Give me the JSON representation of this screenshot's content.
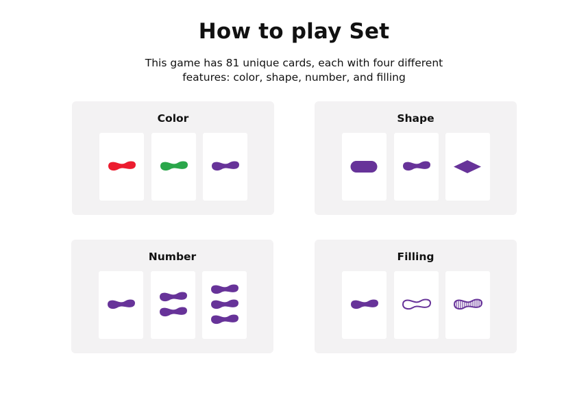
{
  "title": "How to play Set",
  "subtitle": {
    "line1": "This game has 81 unique cards, each with four different",
    "line2": "features: color, shape, number, and filling"
  },
  "colors": {
    "red": "#ec1c2f",
    "green": "#2aa64a",
    "purple": "#673399",
    "panel_bg": "#f3f2f3"
  },
  "panels": [
    {
      "label": "Color",
      "cards": [
        {
          "shape": "squiggle",
          "color": "red",
          "number": 1,
          "filling": "solid"
        },
        {
          "shape": "squiggle",
          "color": "green",
          "number": 1,
          "filling": "solid"
        },
        {
          "shape": "squiggle",
          "color": "purple",
          "number": 1,
          "filling": "solid"
        }
      ]
    },
    {
      "label": "Shape",
      "cards": [
        {
          "shape": "oval",
          "color": "purple",
          "number": 1,
          "filling": "solid"
        },
        {
          "shape": "squiggle",
          "color": "purple",
          "number": 1,
          "filling": "solid"
        },
        {
          "shape": "diamond",
          "color": "purple",
          "number": 1,
          "filling": "solid"
        }
      ]
    },
    {
      "label": "Number",
      "cards": [
        {
          "shape": "squiggle",
          "color": "purple",
          "number": 1,
          "filling": "solid"
        },
        {
          "shape": "squiggle",
          "color": "purple",
          "number": 2,
          "filling": "solid"
        },
        {
          "shape": "squiggle",
          "color": "purple",
          "number": 3,
          "filling": "solid"
        }
      ]
    },
    {
      "label": "Filling",
      "cards": [
        {
          "shape": "squiggle",
          "color": "purple",
          "number": 1,
          "filling": "solid"
        },
        {
          "shape": "squiggle",
          "color": "purple",
          "number": 1,
          "filling": "open"
        },
        {
          "shape": "squiggle",
          "color": "purple",
          "number": 1,
          "filling": "striped"
        }
      ]
    }
  ]
}
